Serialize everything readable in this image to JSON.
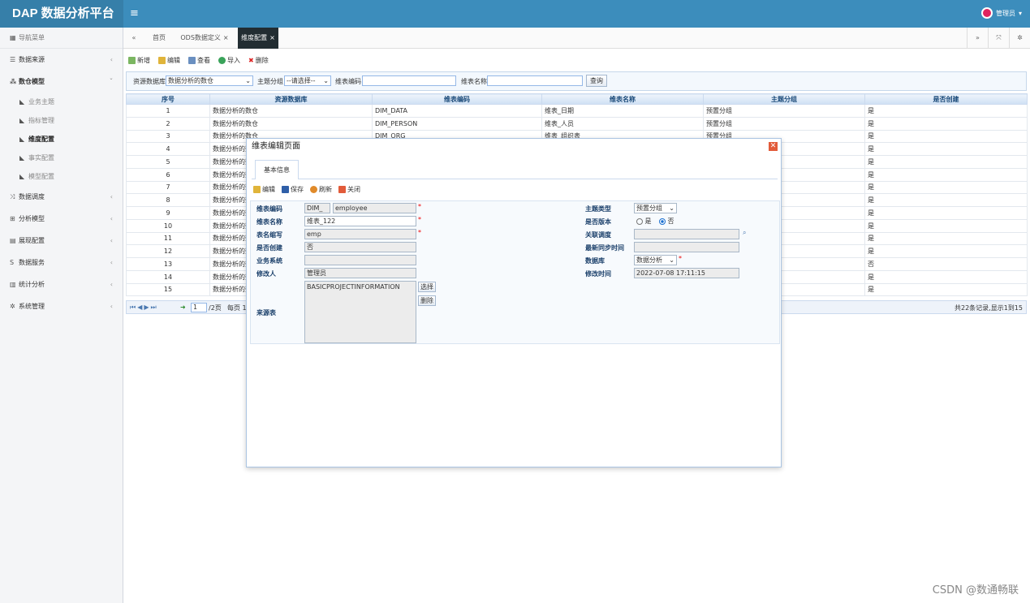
{
  "app": {
    "title": "DAP 数据分析平台",
    "user": "管理员"
  },
  "sidebar": {
    "header": "导航菜单",
    "items": [
      {
        "label": "数据来源"
      },
      {
        "label": "数仓模型",
        "subitems": [
          "业务主题",
          "指标管理",
          "维度配置",
          "事实配置",
          "模型配置"
        ]
      },
      {
        "label": "数据调度"
      },
      {
        "label": "分析模型"
      },
      {
        "label": "展现配置"
      },
      {
        "label": "数据服务"
      },
      {
        "label": "统计分析"
      },
      {
        "label": "系统管理"
      }
    ]
  },
  "tabs": [
    {
      "label": "首页"
    },
    {
      "label": "ODS数据定义"
    },
    {
      "label": "维度配置"
    }
  ],
  "toolbar": {
    "add": "新增",
    "edit": "编辑",
    "view": "查看",
    "import": "导入",
    "delete": "删除"
  },
  "search": {
    "db_label": "资源数据库",
    "db_value": "数据分析的数仓",
    "group_label": "主题分组",
    "group_value": "--请选择--",
    "code_label": "维表编码",
    "name_label": "维表名称",
    "query": "查询"
  },
  "grid": {
    "columns": [
      "序号",
      "资源数据库",
      "维表编码",
      "维表名称",
      "主题分组",
      "是否创建"
    ],
    "rows": [
      [
        "1",
        "数据分析的数仓",
        "DIM_DATA",
        "维表_日期",
        "预置分组",
        "是"
      ],
      [
        "2",
        "数据分析的数仓",
        "DIM_PERSON",
        "维表_人员",
        "预置分组",
        "是"
      ],
      [
        "3",
        "数据分析的数仓",
        "DIM_ORG",
        "维表_组织表",
        "预置分组",
        "是"
      ],
      [
        "4",
        "数据分析的数",
        "",
        "",
        "",
        "是"
      ],
      [
        "5",
        "数据分析的数",
        "",
        "",
        "",
        "是"
      ],
      [
        "6",
        "数据分析的数",
        "",
        "",
        "",
        "是"
      ],
      [
        "7",
        "数据分析的数",
        "",
        "",
        "",
        "是"
      ],
      [
        "8",
        "数据分析的数",
        "",
        "",
        "",
        "是"
      ],
      [
        "9",
        "数据分析的数",
        "",
        "",
        "",
        "是"
      ],
      [
        "10",
        "数据分析的数",
        "",
        "",
        "",
        "是"
      ],
      [
        "11",
        "数据分析的数",
        "",
        "",
        "",
        "是"
      ],
      [
        "12",
        "数据分析的数",
        "",
        "",
        "",
        "是"
      ],
      [
        "13",
        "数据分析的数",
        "",
        "",
        "",
        "否"
      ],
      [
        "14",
        "数据分析的数",
        "",
        "",
        "",
        "是"
      ],
      [
        "15",
        "数据分析的数",
        "",
        "",
        "",
        "是"
      ]
    ]
  },
  "pager": {
    "page": "1",
    "total_pages": "/2页",
    "per_page": "每页 1",
    "summary": "共22条记录,显示1到15"
  },
  "modal": {
    "title": "维表编辑页面",
    "tab": "基本信息",
    "tools": {
      "edit": "编辑",
      "save": "保存",
      "refresh": "刷新",
      "close": "关闭"
    },
    "fields": {
      "code_label": "维表编码",
      "code_prefix": "DIM_",
      "code_value": "employee",
      "name_label": "维表名称",
      "name_value": "维表_122",
      "alias_label": "表名缩写",
      "alias_value": "emp",
      "created_label": "是否创建",
      "created_value": "否",
      "biz_label": "业务系统",
      "biz_value": "",
      "modifier_label": "修改人",
      "modifier_value": "管理员",
      "source_label": "来源表",
      "source_value": "BASICPROJECTINFORMATION",
      "select_btn": "选择",
      "remove_btn": "删除",
      "topic_label": "主题类型",
      "topic_value": "预置分组",
      "version_label": "是否版本",
      "version_yes": "是",
      "version_no": "否",
      "schedule_label": "关联调度",
      "schedule_value": "",
      "sync_label": "最新同步时间",
      "sync_value": "",
      "db_label": "数据库",
      "db_value": "数据分析",
      "mtime_label": "修改时间",
      "mtime_value": "2022-07-08 17:11:15"
    }
  },
  "watermark": "CSDN @数通畅联"
}
